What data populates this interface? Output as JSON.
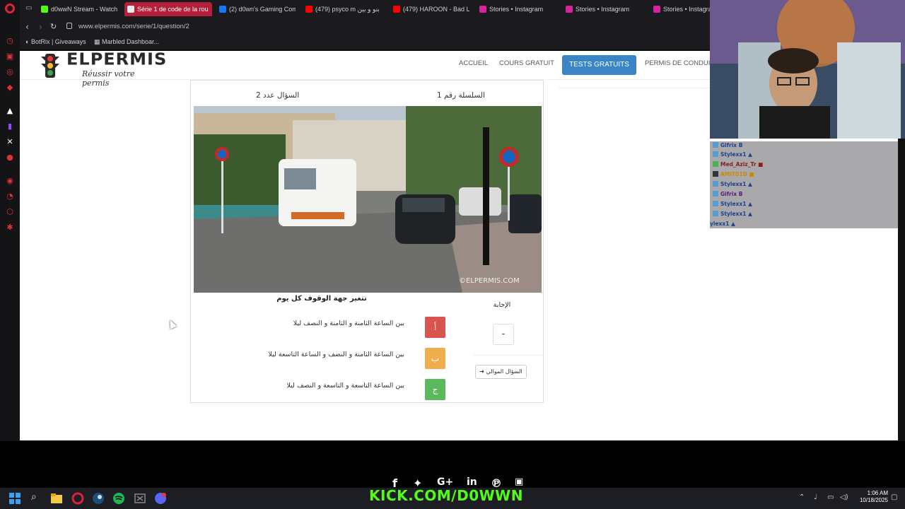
{
  "browser": {
    "tabs": [
      {
        "label": "d0wwN Stream - Watch",
        "color": "#53fc18"
      },
      {
        "label": "Série 1 de code de la rou",
        "color": "#e8e8e8",
        "active": true
      },
      {
        "label": "(2) d0wn's Gaming Com",
        "color": "#1877f2"
      },
      {
        "label": "(479) psyco m بنو و بين",
        "color": "#ff0000"
      },
      {
        "label": "(479) HAROON - Bad Lu",
        "color": "#ff0000"
      },
      {
        "label": "Stories • Instagram",
        "color": "#d6249f"
      },
      {
        "label": "Stories • Instagram",
        "color": "#d6249f"
      },
      {
        "label": "Stories • Instagra",
        "color": "#d6249f"
      }
    ],
    "url": "www.elpermis.com/serie/1/question/2",
    "bookmarks": [
      "BotRix | Giveaways",
      "Marbled Dashboar..."
    ]
  },
  "site": {
    "logo": "ELPERMIS",
    "tagline": "Réussir votre permis",
    "nav": [
      "ACCUEIL",
      "COURS GRATUIT",
      "TESTS GRATUITS",
      "PERMIS DE CONDUIRE"
    ]
  },
  "quiz": {
    "question_number": "السؤال عدد 2",
    "series_number": "السلسلة رقم 1",
    "image_watermark": "©ELPERMIS.COM",
    "caption": "تتغير جهة الوقوف كل يوم",
    "answer_label": "الإجابة",
    "answer_value": "-",
    "next_button": "السؤال الموالي",
    "options": [
      {
        "letter": "أ",
        "text": "بين الساعة الثامنة و الثامنة و النصف ليلا",
        "color": "#d9534f"
      },
      {
        "letter": "ب",
        "text": "بين الساعة الثامنة و النصف و الساعة التاسعة ليلا",
        "color": "#f0ad4e"
      },
      {
        "letter": "ج",
        "text": "بين الساعة التاسعة و التاسعة و النصف ليلا",
        "color": "#5cb85c"
      }
    ]
  },
  "overlay": {
    "kick_url": "KICK.COM/D0WWN",
    "chat": [
      {
        "user": "Gifrix",
        "extra": "B"
      },
      {
        "user": "Stylexx1",
        "extra": "▲"
      },
      {
        "user": "Med_Aziz_Tr",
        "extra": "■"
      },
      {
        "user": "AMIT01D",
        "extra": "■"
      },
      {
        "user": "Stylexx1",
        "extra": "▲"
      },
      {
        "user": "Gifrix",
        "extra": "B"
      },
      {
        "user": "Stylexx1",
        "extra": "▲"
      },
      {
        "user": "Stylexx1",
        "extra": "▲"
      },
      {
        "user": "ylexx1",
        "extra": "▲"
      }
    ]
  },
  "taskbar": {
    "time": "1:06 AM",
    "date": "10/18/2025"
  }
}
